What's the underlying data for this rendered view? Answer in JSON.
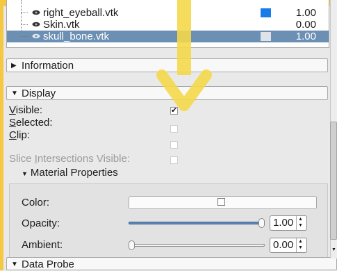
{
  "tree": {
    "rows": [
      {
        "name": "right_eyeball.vtk",
        "value": "1.00",
        "swatch": "#1a7be8",
        "selected": false
      },
      {
        "name": "Skin.vtk",
        "value": "0.00",
        "swatch": "",
        "selected": false
      },
      {
        "name": "skull_bone.vtk",
        "value": "1.00",
        "swatch": "#dfe3e8",
        "selected": true
      }
    ]
  },
  "sections": {
    "information": "Information",
    "display": "Display",
    "data_probe": "Data Probe"
  },
  "display": {
    "visible_label_u": "V",
    "visible_label_rest": "isible:",
    "visible_checked": true,
    "selected_label_u": "S",
    "selected_label_rest": "elected:",
    "selected_checked": false,
    "clip_label_u": "C",
    "clip_label_rest": "lip:",
    "clip_checked": false,
    "slice_label_pre": "Slice ",
    "slice_label_u": "I",
    "slice_label_rest": "ntersections Visible:",
    "slice_checked": false
  },
  "material": {
    "title": "Material Properties",
    "color_label": "Color:",
    "opacity_label": "Opacity:",
    "opacity_value": "1.00",
    "opacity_fraction": 1.0,
    "ambient_label": "Ambient:",
    "ambient_value": "0.00",
    "ambient_fraction": 0.0
  },
  "icons": {
    "tree_visibility": "eye-icon",
    "collapsed_arrow": "triangle-right-icon",
    "expanded_arrow": "triangle-down-icon",
    "annotation": "yellow-down-arrow"
  },
  "colors": {
    "annotation_yellow": "#f5d84a",
    "selection_blue": "#6c8fb4",
    "slider_blue": "#5f86b5"
  }
}
